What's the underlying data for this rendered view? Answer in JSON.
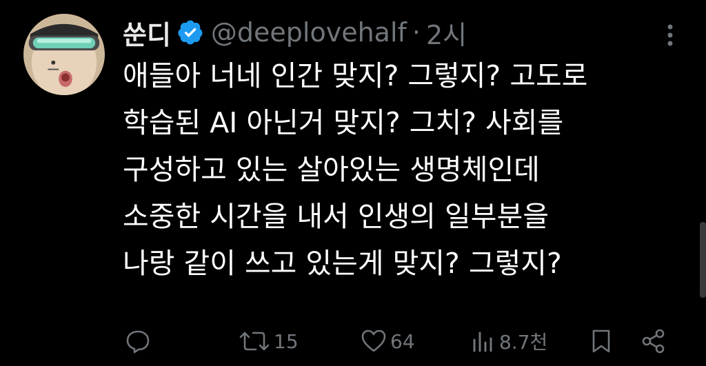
{
  "author": {
    "display_name": "쑨디",
    "handle": "@deeplovehalf",
    "separator": "·",
    "time": "2시"
  },
  "tweet": {
    "lines": [
      "애들아 너네 인간 맞지? 그렇지? 고도로",
      "학습된 AI 아닌거 맞지? 그치? 사회를",
      "구성하고 있는 살아있는 생명체인데",
      "소중한 시간을 내서 인생의 일부분을",
      "나랑 같이 쓰고 있는게 맞지? 그렇지?"
    ]
  },
  "actions": {
    "reply": {
      "icon": "reply-icon"
    },
    "retweet": {
      "icon": "retweet-icon",
      "count": "15"
    },
    "like": {
      "icon": "heart-icon",
      "count": "64"
    },
    "views": {
      "icon": "views-icon",
      "count": "8.7천"
    },
    "bookmark": {
      "icon": "bookmark-icon"
    },
    "share": {
      "icon": "share-icon"
    }
  },
  "colors": {
    "background": "#000000",
    "text": "#ffffff",
    "muted": "#71767b",
    "verified": "#1d9bf0"
  }
}
